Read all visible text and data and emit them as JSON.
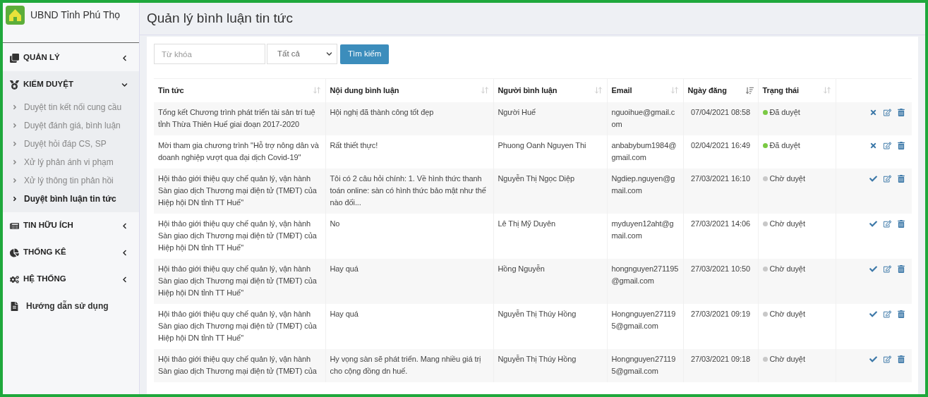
{
  "brand": {
    "name": "UBND Tỉnh Phú Thọ"
  },
  "sidebar": {
    "items": [
      {
        "kind": "group",
        "label": "QUẢN LÝ",
        "expanded": false
      },
      {
        "kind": "group",
        "label": "KIỂM DUYỆT",
        "expanded": true,
        "children": [
          {
            "label": "Duyệt tin kết nối cung cầu",
            "selected": false
          },
          {
            "label": "Duyệt đánh giá, bình luận",
            "selected": false
          },
          {
            "label": "Duyệt hỏi đáp CS, SP",
            "selected": false
          },
          {
            "label": "Xử lý phản ánh vi phạm",
            "selected": false
          },
          {
            "label": "Xử lý thông tin phản hồi",
            "selected": false
          },
          {
            "label": "Duyệt bình luận tin tức",
            "selected": true
          }
        ]
      },
      {
        "kind": "group",
        "label": "TIN HỮU ÍCH",
        "expanded": false
      },
      {
        "kind": "group",
        "label": "THỐNG KÊ",
        "expanded": false
      },
      {
        "kind": "group",
        "label": "HỆ THỐNG",
        "expanded": false
      },
      {
        "kind": "link",
        "label": "Hướng dẫn sử dụng"
      }
    ]
  },
  "page": {
    "title": "Quản lý bình luận tin tức"
  },
  "filters": {
    "keyword": {
      "placeholder": "Từ khóa"
    },
    "select": {
      "value": "Tất cả"
    },
    "search_button": "Tìm kiếm"
  },
  "table": {
    "columns": [
      {
        "label": "Tin tức",
        "sorted": false
      },
      {
        "label": "Nội dung bình luận",
        "sorted": false
      },
      {
        "label": "Người bình luận",
        "sorted": false
      },
      {
        "label": "Email",
        "sorted": false
      },
      {
        "label": "Ngày đăng",
        "sorted": true
      },
      {
        "label": "Trạng thái",
        "sorted": false
      }
    ],
    "rows": [
      {
        "news": "Tổng kết Chương trình phát triển tài sản trí tuệ tỉnh Thừa Thiên Huế giai đoạn 2017-2020",
        "comment": "Hội nghị đã thành công tốt đẹp",
        "author": "Người Huế",
        "email": "nguoihue@gmail.com",
        "date": "07/04/2021 08:58",
        "status": {
          "label": "Đã duyệt",
          "color": "#7ac943"
        },
        "approved": true
      },
      {
        "news": "Mời tham gia chương trình \"Hỗ trợ nông dân và doanh nghiệp vượt qua đại dịch Covid-19\"",
        "comment": "Rất thiết thực!",
        "author": "Phuong Oanh Nguyen Thi",
        "email": "anbabybum1984@gmail.com",
        "date": "02/04/2021 16:49",
        "status": {
          "label": "Đã duyệt",
          "color": "#7ac943"
        },
        "approved": true
      },
      {
        "news": "Hội thảo giới thiệu quy chế quản lý, vận hành Sàn giao dịch Thương mại điện tử (TMĐT) của Hiệp hội DN tỉnh TT Huế\"",
        "comment": "Tôi có 2 câu hỏi chính: 1. Về hình thức thanh toán online: sàn có hình thức bảo mật như thế nào đối...",
        "author": "Nguyễn Thị Ngọc Diệp",
        "email": "Ngdiep.nguyen@gmail.com",
        "date": "27/03/2021 16:10",
        "status": {
          "label": "Chờ duyệt",
          "color": "#c8c8c8"
        },
        "approved": false
      },
      {
        "news": "Hội thảo giới thiệu quy chế quản lý, vận hành Sàn giao dịch Thương mại điện tử (TMĐT) của Hiệp hội DN tỉnh TT Huế\"",
        "comment": "No",
        "author": "Lê Thị Mỹ Duyên",
        "email": "myduyen12aht@gmail.com",
        "date": "27/03/2021 14:06",
        "status": {
          "label": "Chờ duyệt",
          "color": "#c8c8c8"
        },
        "approved": false
      },
      {
        "news": "Hội thảo giới thiệu quy chế quản lý, vận hành Sàn giao dịch Thương mại điện tử (TMĐT) của Hiệp hội DN tỉnh TT Huế\"",
        "comment": "Hay quá",
        "author": "Hồng Nguyễn",
        "email": "hongnguyen271195@gmail.com",
        "date": "27/03/2021 10:50",
        "status": {
          "label": "Chờ duyệt",
          "color": "#c8c8c8"
        },
        "approved": false
      },
      {
        "news": "Hội thảo giới thiệu quy chế quản lý, vận hành Sàn giao dịch Thương mại điện tử (TMĐT) của Hiệp hội DN tỉnh TT Huế\"",
        "comment": "Hay quá",
        "author": "Nguyễn Thị Thúy Hồng",
        "email": "Hongnguyen271195@gmail.com",
        "date": "27/03/2021 09:19",
        "status": {
          "label": "Chờ duyệt",
          "color": "#c8c8c8"
        },
        "approved": false
      },
      {
        "news": "Hội thảo giới thiệu quy chế quản lý, vận hành Sàn giao dịch Thương mại điện tử (TMĐT) của",
        "comment": "Hy vọng sàn sẽ phát triển. Mang nhiều giá trị cho cộng đồng dn huế.",
        "author": "Nguyễn Thị Thúy Hồng",
        "email": "Hongnguyen271195@gmail.com",
        "date": "27/03/2021 09:18",
        "status": {
          "label": "Chờ duyệt",
          "color": "#c8c8c8"
        },
        "approved": false
      }
    ]
  }
}
